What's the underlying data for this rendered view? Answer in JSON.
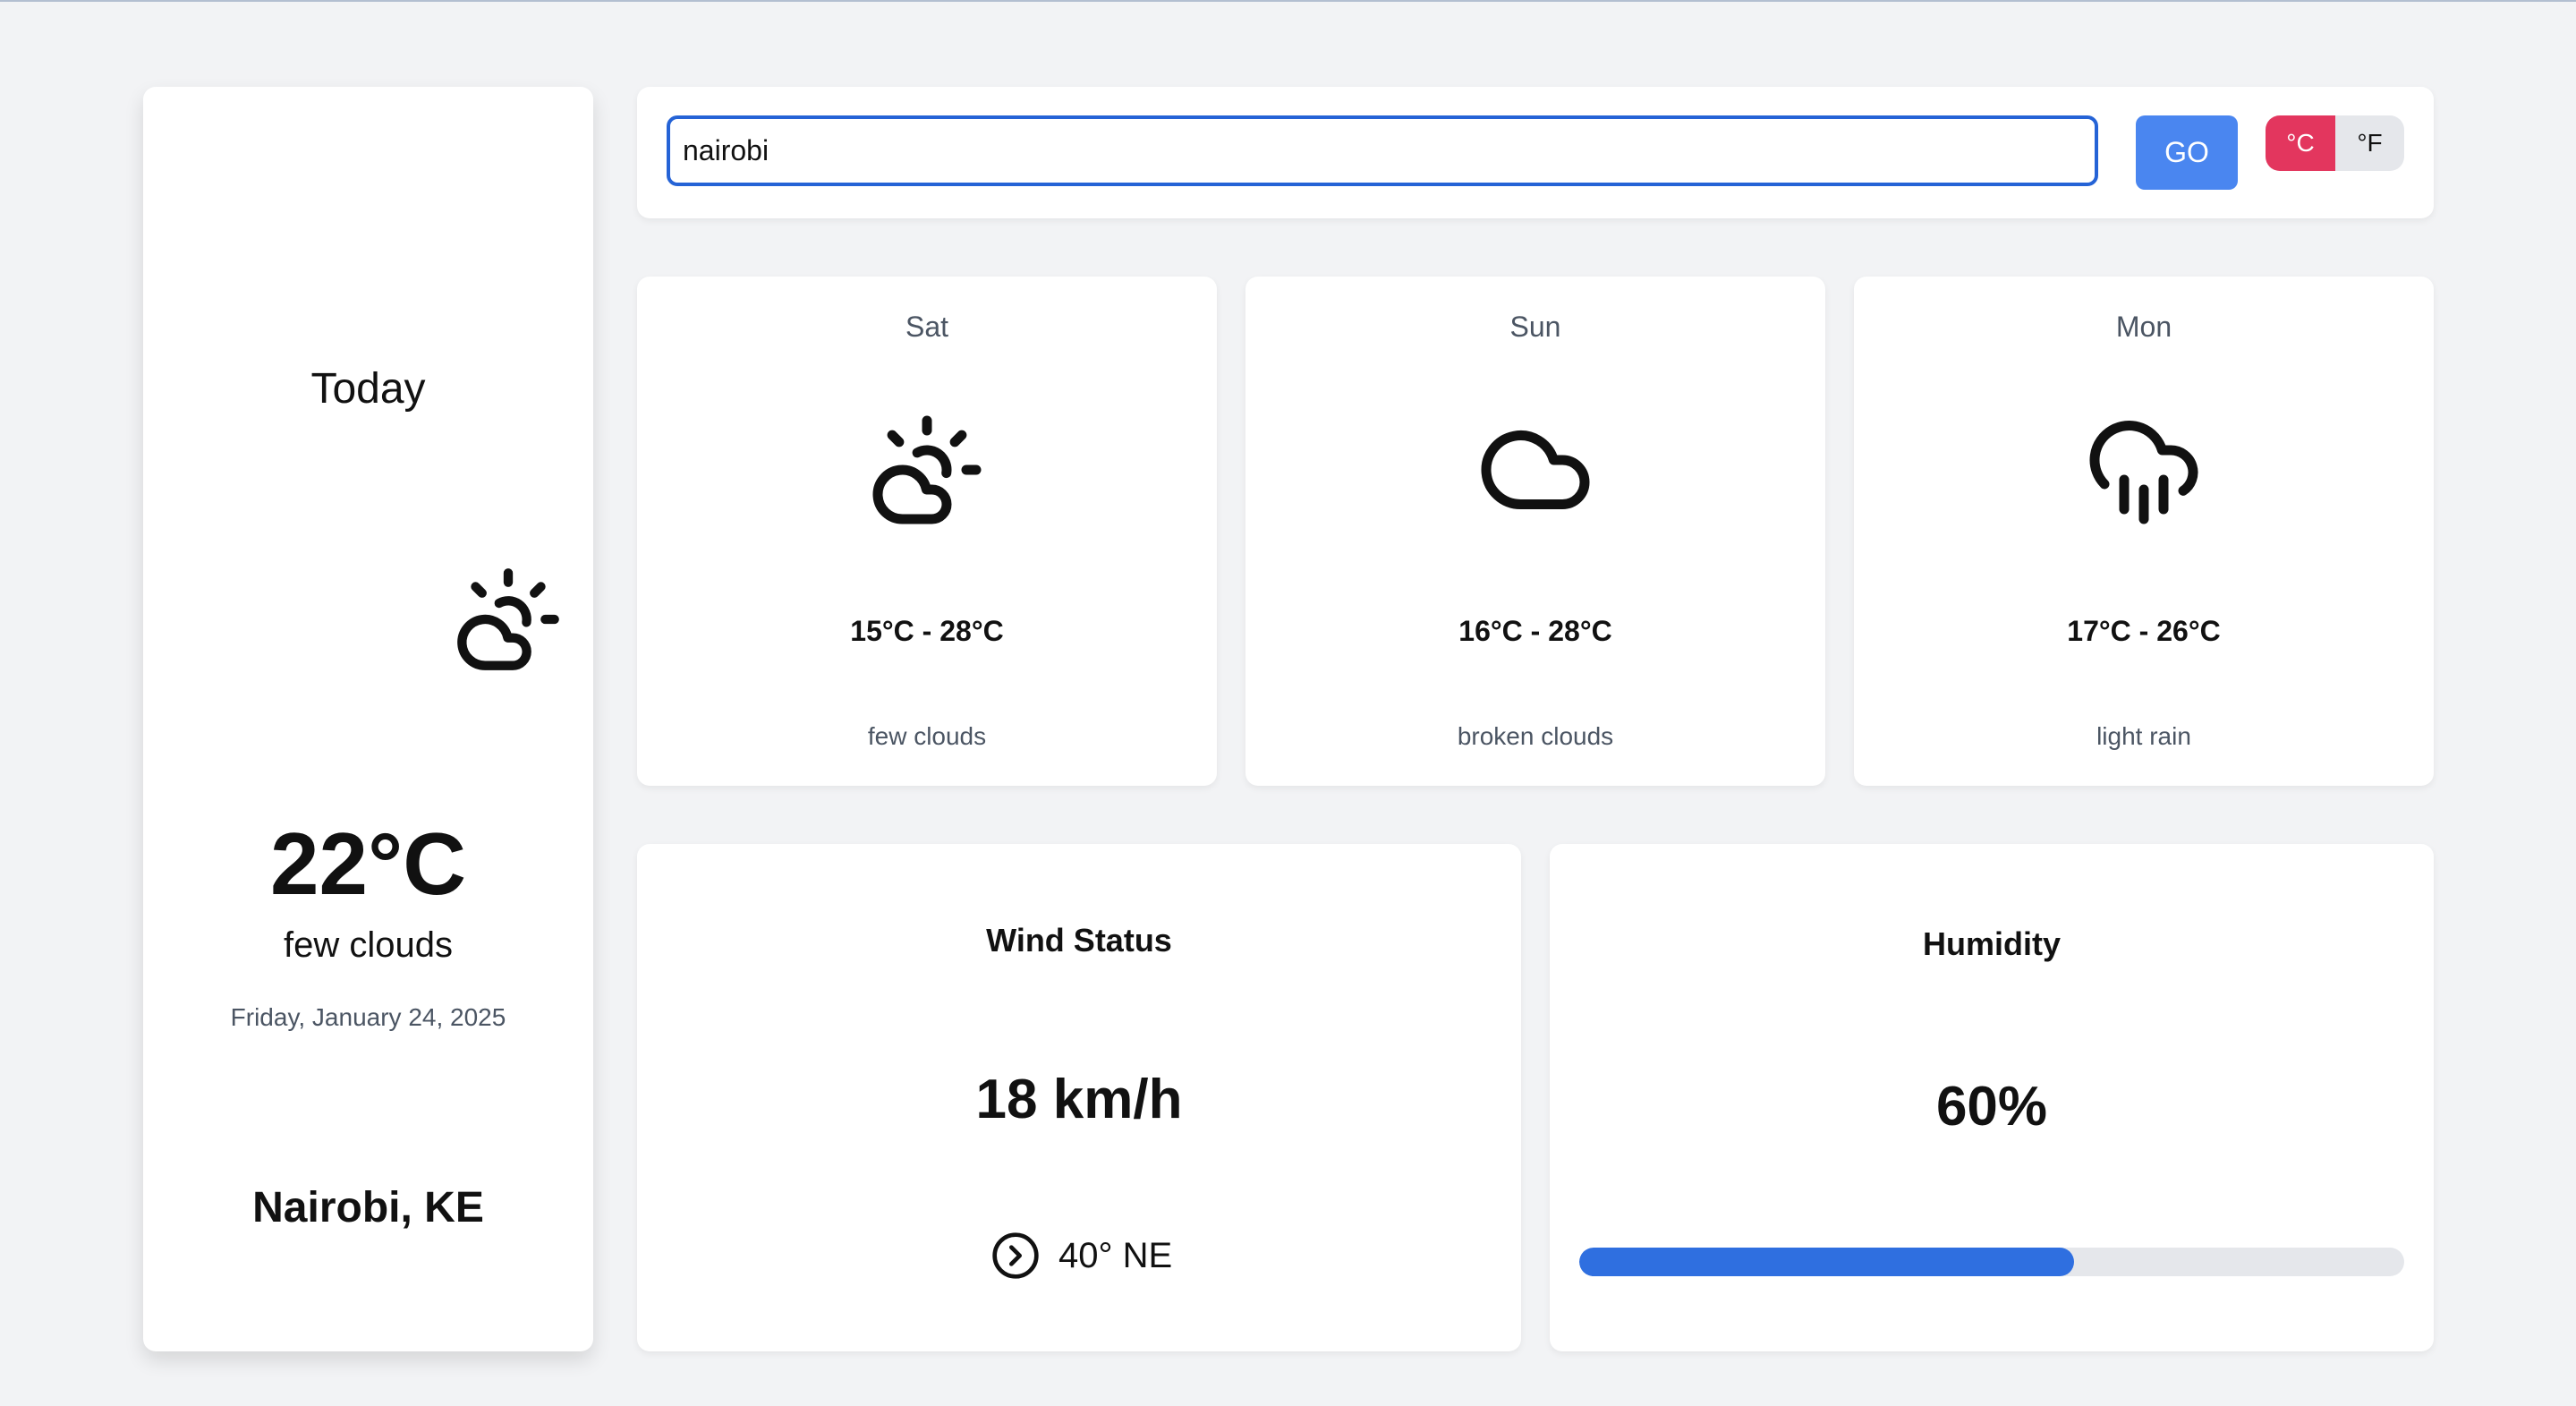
{
  "today": {
    "title": "Today",
    "icon": "cloud-sun-icon",
    "temperature": "22°C",
    "description": "few clouds",
    "date": "Friday, January 24, 2025",
    "location": "Nairobi, KE"
  },
  "search": {
    "value": "nairobi",
    "go_label": "GO"
  },
  "units": {
    "celsius_label": "°C",
    "fahrenheit_label": "°F",
    "selected": "°C"
  },
  "forecast": [
    {
      "day": "Sat",
      "icon": "cloud-sun-icon",
      "range": "15°C - 28°C",
      "description": "few clouds"
    },
    {
      "day": "Sun",
      "icon": "cloud-icon",
      "range": "16°C - 28°C",
      "description": "broken clouds"
    },
    {
      "day": "Mon",
      "icon": "cloud-rain-icon",
      "range": "17°C - 26°C",
      "description": "light rain"
    }
  ],
  "wind": {
    "title": "Wind Status",
    "speed": "18 km/h",
    "direction": "40° NE",
    "icon": "circle-chevron-right-icon"
  },
  "humidity": {
    "title": "Humidity",
    "value": "60%",
    "percent": 60
  },
  "colors": {
    "accent": "#2563d6",
    "go_button": "#4a86f0",
    "celsius_active": "#e3365e",
    "humidity_bar": "#2f6fe0"
  }
}
